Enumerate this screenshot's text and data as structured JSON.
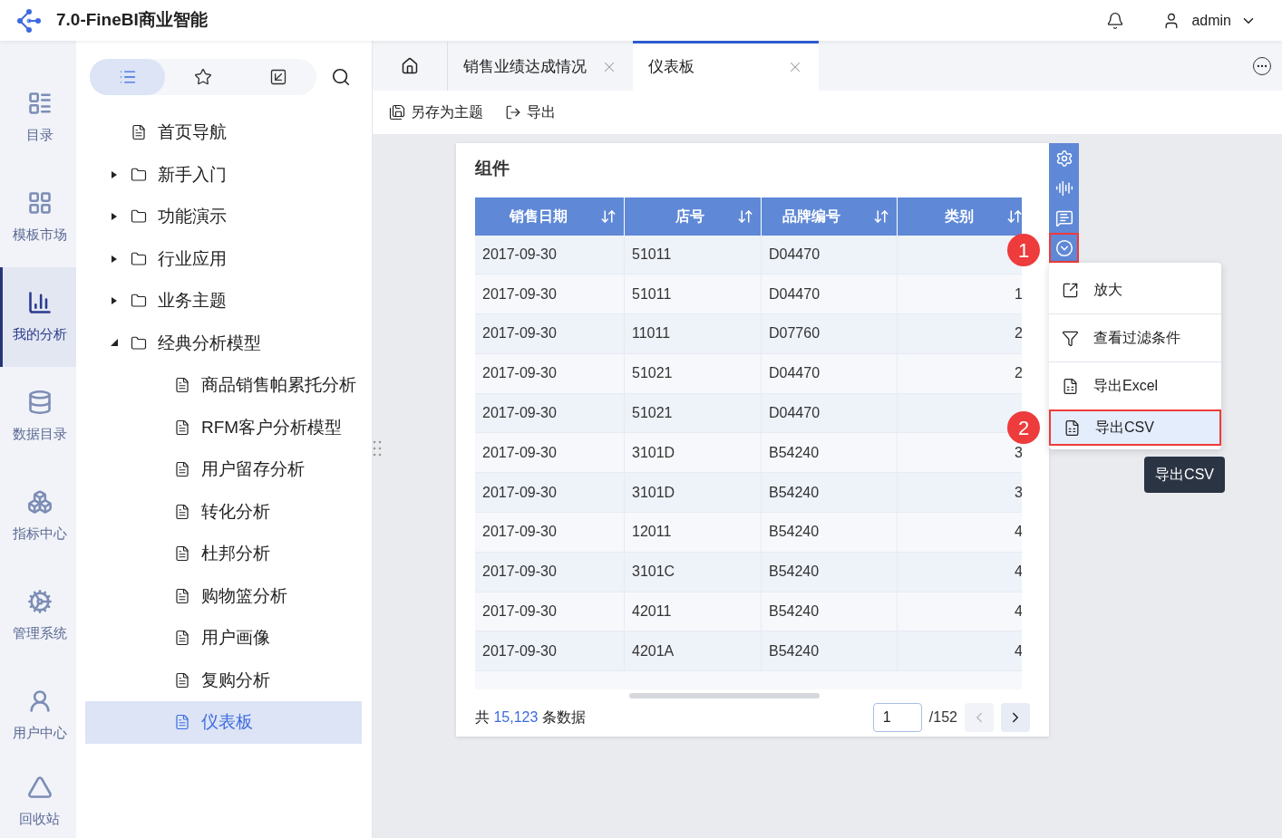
{
  "header": {
    "title": "7.0-FineBI商业智能",
    "user": "admin"
  },
  "nav": [
    {
      "label": "目录",
      "selected": false
    },
    {
      "label": "模板市场",
      "selected": false
    },
    {
      "label": "我的分析",
      "selected": true
    },
    {
      "label": "数据目录",
      "selected": false
    },
    {
      "label": "指标中心",
      "selected": false
    },
    {
      "label": "管理系统",
      "selected": false
    },
    {
      "label": "用户中心",
      "selected": false
    },
    {
      "label": "回收站",
      "selected": false
    }
  ],
  "tree_tabs": [
    {
      "selected": true
    },
    {
      "selected": false
    },
    {
      "selected": false
    }
  ],
  "tree": [
    {
      "label": "首页导航",
      "kind": "doc",
      "selected": false
    },
    {
      "label": "新手入门",
      "kind": "folder",
      "expanded": false,
      "selected": false
    },
    {
      "label": "功能演示",
      "kind": "folder",
      "expanded": false,
      "selected": false
    },
    {
      "label": "行业应用",
      "kind": "folder",
      "expanded": false,
      "selected": false
    },
    {
      "label": "业务主题",
      "kind": "folder",
      "expanded": false,
      "selected": false
    },
    {
      "label": "经典分析模型",
      "kind": "folder",
      "expanded": true,
      "selected": false,
      "children": [
        {
          "label": "商品销售帕累托分析",
          "kind": "doc",
          "selected": false
        },
        {
          "label": "RFM客户分析模型",
          "kind": "doc",
          "selected": false
        },
        {
          "label": "用户留存分析",
          "kind": "doc",
          "selected": false
        },
        {
          "label": "转化分析",
          "kind": "doc",
          "selected": false
        },
        {
          "label": "杜邦分析",
          "kind": "doc",
          "selected": false
        },
        {
          "label": "购物篮分析",
          "kind": "doc",
          "selected": false
        },
        {
          "label": "用户画像",
          "kind": "doc",
          "selected": false
        },
        {
          "label": "复购分析",
          "kind": "doc",
          "selected": false
        },
        {
          "label": "仪表板",
          "kind": "doc",
          "selected": true
        }
      ]
    }
  ],
  "tabs": [
    {
      "label": "销售业绩达成情况",
      "selected": false
    },
    {
      "label": "仪表板",
      "selected": true
    }
  ],
  "toolbar": [
    {
      "label": "另存为主题",
      "kind": "save"
    },
    {
      "label": "导出",
      "kind": "export"
    }
  ],
  "card": {
    "title": "组件",
    "columns": [
      "销售日期",
      "店号",
      "品牌编号",
      "类别"
    ],
    "rows": [
      [
        "2017-09-30",
        "51011",
        "D04470",
        ""
      ],
      [
        "2017-09-30",
        "51011",
        "D04470",
        "1"
      ],
      [
        "2017-09-30",
        "11011",
        "D07760",
        "2"
      ],
      [
        "2017-09-30",
        "51021",
        "D04470",
        "2"
      ],
      [
        "2017-09-30",
        "51021",
        "D04470",
        ""
      ],
      [
        "2017-09-30",
        "3101D",
        "B54240",
        "3"
      ],
      [
        "2017-09-30",
        "3101D",
        "B54240",
        "3"
      ],
      [
        "2017-09-30",
        "12011",
        "B54240",
        "4"
      ],
      [
        "2017-09-30",
        "3101C",
        "B54240",
        "4"
      ],
      [
        "2017-09-30",
        "42011",
        "B54240",
        "4"
      ],
      [
        "2017-09-30",
        "4201A",
        "B54240",
        "4"
      ]
    ],
    "footer": {
      "prefix": "共",
      "count": "15,123",
      "suffix": "条数据",
      "page": "1",
      "total": "/152"
    }
  },
  "card_tools": [
    {
      "kind": "settings",
      "selected": false
    },
    {
      "kind": "chart",
      "selected": false
    },
    {
      "kind": "comment",
      "selected": false
    },
    {
      "kind": "more",
      "selected": true
    }
  ],
  "menu": [
    {
      "label": "放大",
      "kind": "zoom",
      "selected": false
    },
    {
      "label": "查看过滤条件",
      "kind": "filter",
      "selected": false
    },
    {
      "label": "导出Excel",
      "kind": "export",
      "selected": false
    },
    {
      "label": "导出CSV",
      "kind": "export",
      "selected": true
    }
  ],
  "badges": [
    "1",
    "2"
  ],
  "tooltip": "导出CSV"
}
